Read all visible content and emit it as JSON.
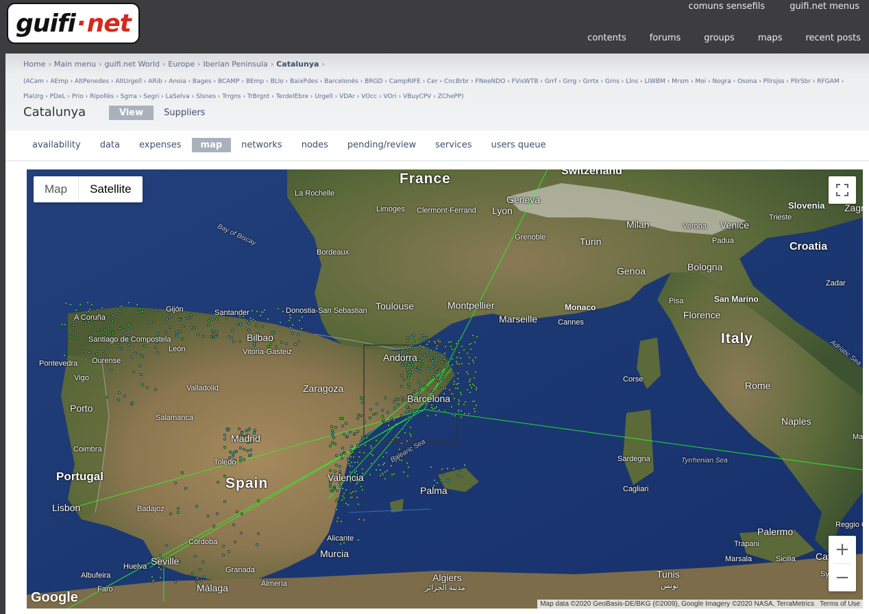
{
  "logo": {
    "part1": "guifi",
    "dot": "·",
    "part2": "net"
  },
  "top_menu": [
    "comuns sensefils",
    "guifi.net menus"
  ],
  "main_menu": [
    "contents",
    "forums",
    "groups",
    "maps",
    "recent posts"
  ],
  "breadcrumb": [
    "Home",
    "Main menu",
    "guifi.net World",
    "Europe",
    "Iberian Peninsula",
    "Catalunya"
  ],
  "breadcrumb_sep": "›",
  "subnets_line1": "(ACam › AEmp › AltPenedes › AltUrgell › ARib › Anoia › Bages › BCAMP › BEmp › BLlo › BaixPdes › Barcelonès › BRGD › CampRIFE › Cer › CncBrbr › FNeeNDO › FVisWTB › Grrf › Grrg › Grrtx › Grns › Llns › LlWBM › Mrsm › Moi › Nogra › Osona › Pllrsjss › PllrSbr › RFGAM ›",
  "subnets_line2": "PlaUrg › PDeL › Prio › Ripollès › Sgrra › Segri › LaSelva › Slsnes › Trrgns › TrBrgnt › TerdelEbre › Urgell › VDAr › VOcc › VOri › VBuyCPV › ZChePP)",
  "page_title": "Catalunya",
  "view_tabs": [
    {
      "label": "View",
      "active": true
    },
    {
      "label": "Suppliers",
      "active": false
    }
  ],
  "sub_tabs": [
    {
      "label": "availability",
      "active": false
    },
    {
      "label": "data",
      "active": false
    },
    {
      "label": "expenses",
      "active": false
    },
    {
      "label": "map",
      "active": true
    },
    {
      "label": "networks",
      "active": false
    },
    {
      "label": "nodes",
      "active": false
    },
    {
      "label": "pending/review",
      "active": false
    },
    {
      "label": "services",
      "active": false
    },
    {
      "label": "users queue",
      "active": false
    }
  ],
  "map": {
    "type_buttons": [
      {
        "label": "Map",
        "active": false
      },
      {
        "label": "Satellite",
        "active": true
      }
    ],
    "fullscreen_icon": "fullscreen-icon",
    "zoom_in": "+",
    "zoom_out": "−",
    "google_logo": "Google",
    "attribution": "Map data ©2020 GeoBasis-DE/BKG (©2009), Google Imagery ©2020 NASA, TerraMetrics",
    "terms": "Terms of Use",
    "labels": {
      "countries": [
        "France",
        "Switzerland",
        "Spain",
        "Portugal",
        "Italy",
        "Croatia",
        "Slovenia"
      ],
      "zagreb": "Zagreb",
      "cities": [
        "La Rochelle",
        "Limoges",
        "Clermont-Ferrand",
        "Lyon",
        "Geneva",
        "Milan",
        "Venice",
        "Verona",
        "Trieste",
        "Padua",
        "Grenoble",
        "Turin",
        "Bologna",
        "Genoa",
        "Bordeaux",
        "Toulouse",
        "Montpellier",
        "Marseille",
        "Monaco",
        "Cannes",
        "Pisa",
        "San Marino",
        "Florence",
        "Santander",
        "Donostia-San Sebastian",
        "Bilbao",
        "Vitoria-Gasteiz",
        "León",
        "A Coruña",
        "Gijón",
        "Santiago de Compostela",
        "Ourense",
        "Pontevedra",
        "Vigo",
        "Andorra",
        "Zaragoza",
        "Valladolid",
        "Salamanca",
        "Porto",
        "Madrid",
        "Coimbra",
        "Toledo",
        "Lisbon",
        "Badajoz",
        "Valencia",
        "Barcelona",
        "Palma",
        "Corse",
        "Rome",
        "Naples",
        "Sardegna",
        "Cagliari",
        "Zadar",
        "Palermo",
        "Trapani",
        "Marsala",
        "Sicilia",
        "Catania",
        "Syracuse",
        "Reggio Calabria",
        "Tunis",
        "Algiers",
        "Murcia",
        "Alicante",
        "Córdoba",
        "Seville",
        "Granada",
        "Almería",
        "Málaga",
        "Huelva",
        "Faro",
        "Albufeira",
        "Mater"
      ],
      "seas": [
        "Bay of Biscay",
        "Balearic Sea",
        "Tyrrhenian Sea",
        "Adriatic Sea"
      ],
      "tunis_ar": "تونس",
      "algiers_ar": "مدينة الجزائر"
    }
  },
  "colors": {
    "header_bg": "#3d3d3f",
    "tab_active": "#a9b1bc",
    "link": "#3e4f6f",
    "logo_red": "#d6291e",
    "network_link": "#22ff22",
    "node_dot": "#33ddee"
  }
}
